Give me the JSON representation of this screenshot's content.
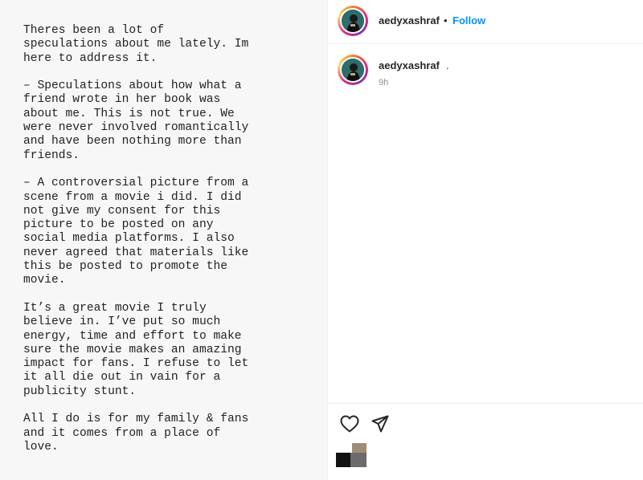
{
  "post": {
    "caption_image_text": "Theres been a lot of\nspeculations about me lately. Im\nhere to address it.\n\n– Speculations about how what a\nfriend wrote in her book was\nabout me. This is not true. We\nwere never involved romantically\nand have been nothing more than\nfriends.\n\n– A controversial picture from a\nscene from a movie i did. I did\nnot give my consent for this\npicture to be posted on any\nsocial media platforms. I also\nnever agreed that materials like\nthis be posted to promote the\nmovie.\n\nIt’s a great movie I truly\nbelieve in. I’ve put so much\nenergy, time and effort to make\nsure the movie makes an amazing\nimpact for fans. I refuse to let\nit all die out in vain for a\npublicity stunt.\n\nAll I do is for my family & fans\nand it comes from a place of\nlove."
  },
  "header": {
    "username": "aedyxashraf",
    "separator": "•",
    "follow_label": "Follow"
  },
  "comment": {
    "username": "aedyxashraf",
    "text": ".",
    "time": "9h"
  },
  "actions": {
    "like_icon": "heart-icon",
    "share_icon": "paper-plane-icon"
  },
  "colors": {
    "follow_blue": "#0095f6",
    "text_dark": "#262626",
    "muted": "#8e8e8e"
  }
}
